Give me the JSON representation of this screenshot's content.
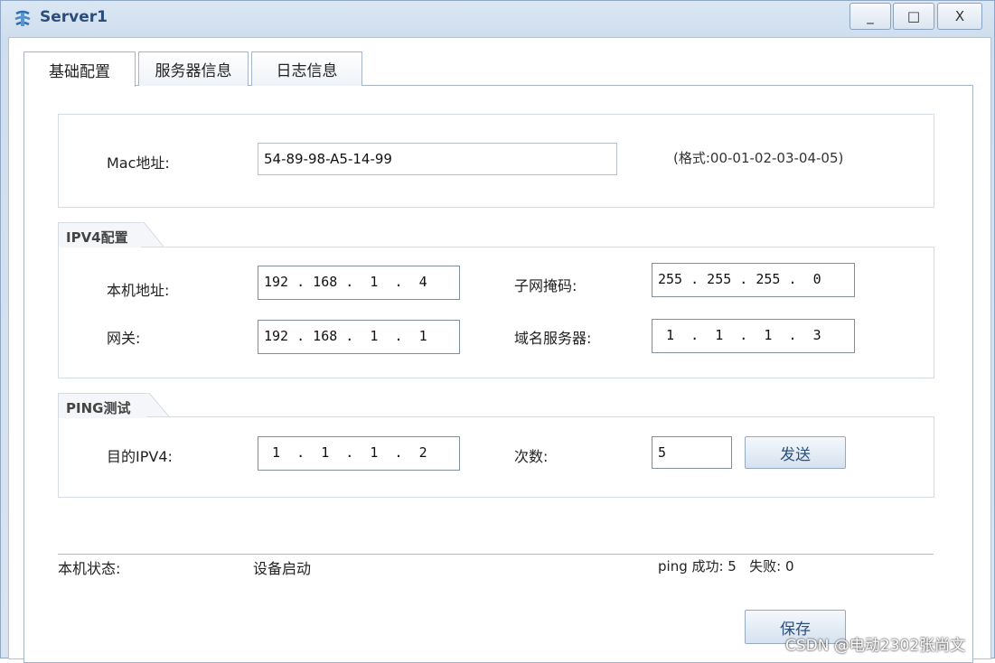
{
  "window": {
    "title": "Server1",
    "minimize_label": "_",
    "maximize_label": "□",
    "close_label": "X"
  },
  "tabs": [
    {
      "label": "基础配置",
      "active": true
    },
    {
      "label": "服务器信息",
      "active": false
    },
    {
      "label": "日志信息",
      "active": false
    }
  ],
  "mac": {
    "label": "Mac地址:",
    "value": "54-89-98-A5-14-99",
    "hint": "(格式:00-01-02-03-04-05)"
  },
  "ipv4": {
    "group_title": "IPV4配置",
    "local_address_label": "本机地址:",
    "local_address": "192 . 168 .  1  .  4",
    "subnet_mask_label": "子网掩码:",
    "subnet_mask": "255 . 255 . 255 .  0",
    "gateway_label": "网关:",
    "gateway": "192 . 168 .  1  .  1",
    "dns_label": "域名服务器:",
    "dns": " 1  .  1  .  1  .  3"
  },
  "ping": {
    "group_title": "PING测试",
    "target_label": "目的IPV4:",
    "target": " 1  .  1  .  1  .  2",
    "count_label": "次数:",
    "count": "5",
    "send_label": "发送"
  },
  "status": {
    "label": "本机状态:",
    "value": "设备启动",
    "ping_result": "ping 成功: 5   失败: 0"
  },
  "save_label": "保存",
  "watermark": "CSDN @电动2302张尚文"
}
